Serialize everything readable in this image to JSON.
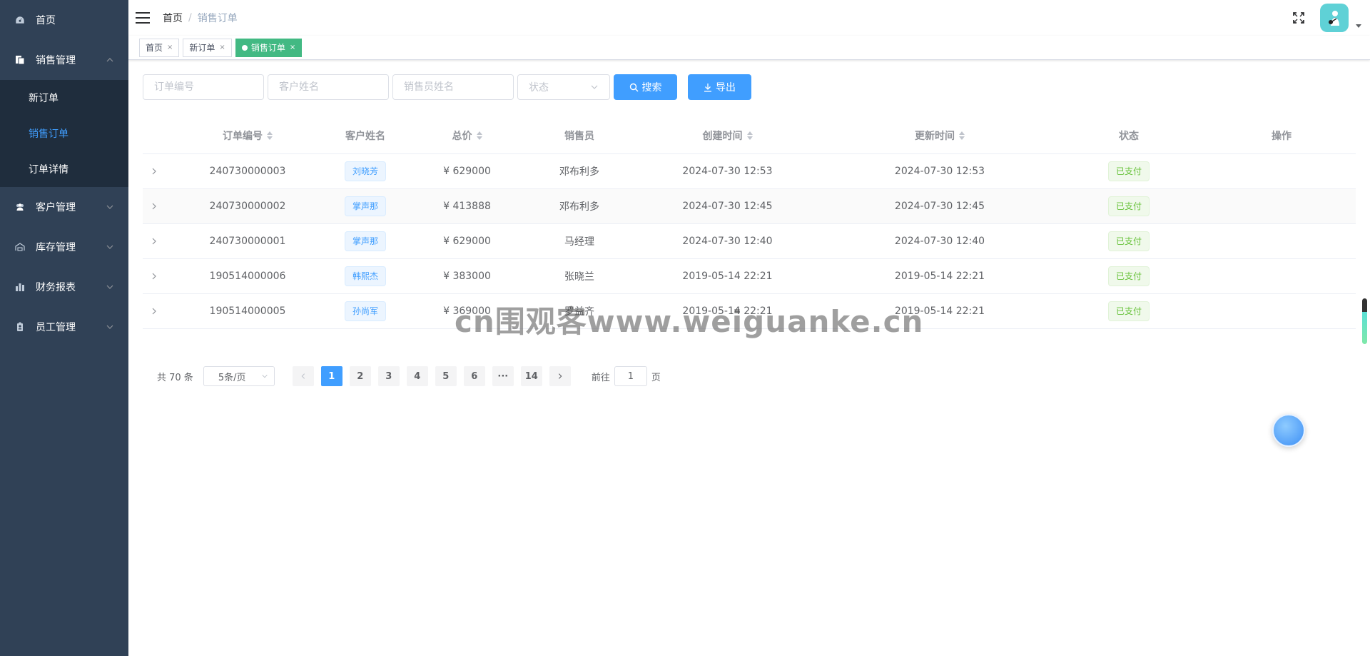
{
  "sidebar": {
    "items": [
      {
        "label": "首页",
        "icon": "dashboard-icon"
      },
      {
        "label": "销售管理",
        "icon": "document-icon",
        "expanded": true,
        "children": [
          {
            "label": "新订单",
            "active": false
          },
          {
            "label": "销售订单",
            "active": true
          },
          {
            "label": "订单详情",
            "active": false
          }
        ]
      },
      {
        "label": "客户管理",
        "icon": "users-icon"
      },
      {
        "label": "库存管理",
        "icon": "warehouse-icon"
      },
      {
        "label": "财务报表",
        "icon": "bar-chart-icon"
      },
      {
        "label": "员工管理",
        "icon": "badge-icon"
      }
    ]
  },
  "navbar": {
    "breadcrumb_home": "首页",
    "breadcrumb_separator": "/",
    "breadcrumb_current": "销售订单"
  },
  "tags": [
    {
      "label": "首页",
      "close": "×",
      "active": false
    },
    {
      "label": "新订单",
      "close": "×",
      "active": false
    },
    {
      "label": "销售订单",
      "close": "×",
      "active": true
    }
  ],
  "filters": {
    "order_no_placeholder": "订单编号",
    "customer_placeholder": "客户姓名",
    "salesperson_placeholder": "销售员姓名",
    "status_placeholder": "状态",
    "search_label": "搜索",
    "export_label": "导出"
  },
  "table": {
    "headers": [
      "订单编号",
      "客户姓名",
      "总价",
      "销售员",
      "创建时间",
      "更新时间",
      "状态",
      "操作"
    ],
    "rows": [
      {
        "order_no": "240730000003",
        "customer": "刘晓芳",
        "price": "¥ 629000",
        "salesperson": "邓布利多",
        "created": "2024-07-30 12:53",
        "updated": "2024-07-30 12:53",
        "status": "已支付"
      },
      {
        "order_no": "240730000002",
        "customer": "掌声那",
        "price": "¥ 413888",
        "salesperson": "邓布利多",
        "created": "2024-07-30 12:45",
        "updated": "2024-07-30 12:45",
        "status": "已支付"
      },
      {
        "order_no": "240730000001",
        "customer": "掌声那",
        "price": "¥ 629000",
        "salesperson": "马经理",
        "created": "2024-07-30 12:40",
        "updated": "2024-07-30 12:40",
        "status": "已支付"
      },
      {
        "order_no": "190514000006",
        "customer": "韩熙杰",
        "price": "¥ 383000",
        "salesperson": "张晓兰",
        "created": "2019-05-14 22:21",
        "updated": "2019-05-14 22:21",
        "status": "已支付"
      },
      {
        "order_no": "190514000005",
        "customer": "孙尚军",
        "price": "¥ 369000",
        "salesperson": "罗益齐",
        "created": "2019-05-14 22:21",
        "updated": "2019-05-14 22:21",
        "status": "已支付"
      }
    ]
  },
  "pagination": {
    "total_text": "共 70 条",
    "page_size": "5条/页",
    "pages": [
      "1",
      "2",
      "3",
      "4",
      "5",
      "6",
      "···",
      "14"
    ],
    "current_page": "1",
    "goto_prefix": "前往",
    "goto_value": "1",
    "goto_suffix": "页"
  },
  "watermark": "cn围观客www.weiguanke.cn",
  "colors": {
    "sidebar_bg": "#304156",
    "submenu_bg": "#1f2d3d",
    "primary": "#409eff",
    "active_tag": "#42b983",
    "success": "#67c23a"
  }
}
